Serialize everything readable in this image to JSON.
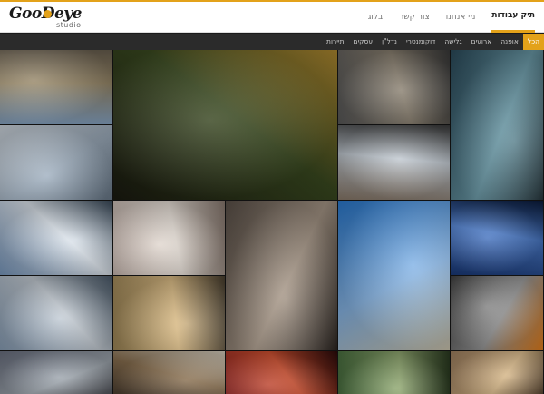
{
  "header": {
    "logo_text": "GooDeye",
    "logo_sub": "studio",
    "nav": [
      {
        "label": "תיק עבודות",
        "active": true
      },
      {
        "label": "מי אנחנו",
        "active": false
      },
      {
        "label": "צור קשר",
        "active": false
      },
      {
        "label": "בלוג",
        "active": false
      }
    ]
  },
  "categories": [
    {
      "label": "הכל",
      "active": true
    },
    {
      "label": "אופנה",
      "active": false
    },
    {
      "label": "ארועים",
      "active": false
    },
    {
      "label": "גלישה",
      "active": false
    },
    {
      "label": "דוקומנטרי",
      "active": false
    },
    {
      "label": "נדל\"ן",
      "active": false
    },
    {
      "label": "עסקים",
      "active": false
    },
    {
      "label": "תיירות",
      "active": false
    }
  ],
  "colors": {
    "accent": "#e3a21a"
  },
  "gallery": [
    {
      "name": "photo-jeep-convoy-mountains",
      "colors": [
        "#8aa8c8",
        "#9a8a6a",
        "#6a6050"
      ]
    },
    {
      "name": "photo-clown-with-glasses",
      "colors": [
        "#1a1a10",
        "#3a4a20",
        "#b08a30"
      ]
    },
    {
      "name": "photo-craftsman-workshop",
      "colors": [
        "#5a5a5a",
        "#8a8070",
        "#3a3a3a"
      ]
    },
    {
      "name": "photo-aerial-performer",
      "colors": [
        "#2a4a5a",
        "#6a9aa8",
        "#1a2a30"
      ]
    },
    {
      "name": "photo-snowboarder-jump",
      "colors": [
        "#d0d8e0",
        "#a0b0c0",
        "#6a7a8a"
      ]
    },
    {
      "name": "photo-model-driftwood-beach",
      "colors": [
        "#8a7a6a",
        "#c0c8d0",
        "#3a3a3a"
      ]
    },
    {
      "name": "photo-snow-cabin-ladder",
      "colors": [
        "#7a9ac0",
        "#e0e8f0",
        "#3a4a5a"
      ]
    },
    {
      "name": "photo-pearl-necklace",
      "colors": [
        "#c8b8b0",
        "#e8e0d8",
        "#8a7a70"
      ]
    },
    {
      "name": "photo-woman-hanging-bar",
      "colors": [
        "#5a5048",
        "#a89888",
        "#2a2420"
      ]
    },
    {
      "name": "photo-pool-slide",
      "colors": [
        "#2a7ad0",
        "#8ab8e8",
        "#d0c8b0"
      ]
    },
    {
      "name": "photo-blue-signage",
      "colors": [
        "#1a3a7a",
        "#4a7ac8",
        "#0a1a3a"
      ]
    },
    {
      "name": "photo-marina-boats",
      "colors": [
        "#8aa0b8",
        "#c8d0d8",
        "#4a5a6a"
      ]
    },
    {
      "name": "photo-field-workers-sunset",
      "colors": [
        "#a08858",
        "#e0c088",
        "#4a4030"
      ]
    },
    {
      "name": "photo-car-wheel-orange",
      "colors": [
        "#3a3a3a",
        "#9a9a9a",
        "#e8801a"
      ]
    },
    {
      "name": "photo-armored-figure",
      "colors": [
        "#6a7080",
        "#a0a8b0",
        "#3a3a40"
      ]
    },
    {
      "name": "photo-crowd-flag",
      "colors": [
        "#3a3028",
        "#8a7050",
        "#d8d0c0"
      ]
    },
    {
      "name": "photo-curly-hair-stage",
      "colors": [
        "#8a2020",
        "#d05030",
        "#2a0a0a"
      ]
    },
    {
      "name": "photo-woman-forest",
      "colors": [
        "#4a7040",
        "#90a870",
        "#2a3a20"
      ]
    },
    {
      "name": "photo-face-paint",
      "colors": [
        "#a08060",
        "#d8b888",
        "#3a2818"
      ]
    }
  ]
}
